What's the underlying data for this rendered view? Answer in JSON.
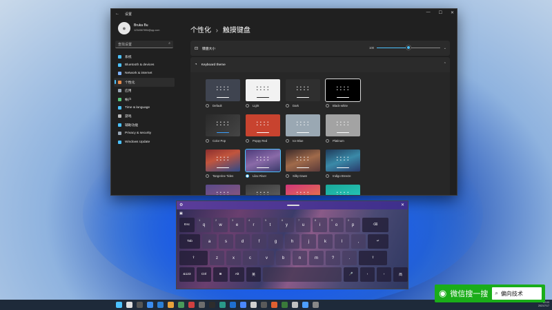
{
  "settings": {
    "window_title": "设置",
    "profile": {
      "name": "Bruka Bu",
      "email": "1234567894@qq.com"
    },
    "search_placeholder": "查找设置",
    "nav": [
      {
        "label": "系统",
        "color": "#4cc2ff"
      },
      {
        "label": "Bluetooth & devices",
        "color": "#4cc2ff"
      },
      {
        "label": "Network & internet",
        "color": "#7fb3ff"
      },
      {
        "label": "个性化",
        "color": "#e88c4c",
        "active": true
      },
      {
        "label": "应用",
        "color": "#9aa7b5"
      },
      {
        "label": "帐户",
        "color": "#59c47a"
      },
      {
        "label": "Time & language",
        "color": "#4cc2ff"
      },
      {
        "label": "游戏",
        "color": "#bbbbbb"
      },
      {
        "label": "辅助功能",
        "color": "#4cc2ff"
      },
      {
        "label": "Privacy & security",
        "color": "#9aa7b5"
      },
      {
        "label": "Windows Update",
        "color": "#4cc2ff"
      }
    ],
    "breadcrumb": {
      "parent": "个性化",
      "separator": "›",
      "current": "触摸键盘"
    },
    "keyboard_size": {
      "label": "键盘大小",
      "value": "100",
      "fraction": 0.5
    },
    "keyboard_theme": {
      "label": "Keyboard theme",
      "themes": [
        {
          "name": "Default",
          "bg": "#3f4450",
          "key": "#ffffff",
          "bar": "#ffffff"
        },
        {
          "name": "Light",
          "bg": "#f2f2f2",
          "key": "#222222",
          "bar": "#222222"
        },
        {
          "name": "Dark",
          "bg": "#2f2f2f",
          "key": "#ffffff",
          "bar": "#ffffff"
        },
        {
          "name": "Black-white",
          "bg": "#000000",
          "key": "#ffffff",
          "bar": "#ffffff",
          "border": true
        },
        {
          "name": "Color Pop",
          "bg": "linear-gradient(135deg,#2a2a2a,#454545)",
          "key": "#ffffff",
          "bar": "#3aa0ff"
        },
        {
          "name": "Poppy Red",
          "bg": "#c8432f",
          "key": "#ffffff",
          "bar": "#ffffff"
        },
        {
          "name": "Ice Blue",
          "bg": "#9aa8b3",
          "key": "#ffffff",
          "bar": "#ffffff"
        },
        {
          "name": "Platinum",
          "bg": "#a3a3a3",
          "key": "#ffffff",
          "bar": "#ffffff"
        },
        {
          "name": "Tangerine Tides",
          "bg": "linear-gradient(160deg,#8a2e2e,#c2553d 40%,#2e4a8a)",
          "key": "#ffffff",
          "bar": "#ffffff"
        },
        {
          "name": "Lilac River",
          "bg": "linear-gradient(160deg,#4b3b7a,#8a6aa8 50%,#3a3a6a)",
          "key": "#ffffff",
          "bar": "#ffffff",
          "selected": true
        },
        {
          "name": "Silky Dawn",
          "bg": "linear-gradient(160deg,#3a2a2a,#a06a4a 50%,#5a3a3a)",
          "key": "#ffffff",
          "bar": "#ffffff"
        },
        {
          "name": "Indigo Breeze",
          "bg": "linear-gradient(160deg,#1f3a5a,#3a8aa8 50%,#2a3a6a)",
          "key": "#ffffff",
          "bar": "#ffffff"
        },
        {
          "name": "",
          "bg": "linear-gradient(160deg,#5a4a8a,#9a5a7a)",
          "key": "#ffffff",
          "bar": "#ffffff"
        },
        {
          "name": "",
          "bg": "linear-gradient(160deg,#3a3a3a,#6a6a6a)",
          "key": "#ffffff",
          "bar": "#ffffff"
        },
        {
          "name": "",
          "bg": "linear-gradient(160deg,#d0357a,#f08a3a)",
          "key": "#ffffff",
          "bar": "#ffffff"
        },
        {
          "name": "",
          "bg": "linear-gradient(160deg,#1aa89a,#2ad0c0)",
          "key": "#ffffff",
          "bar": "#ffffff"
        }
      ]
    }
  },
  "keyboard": {
    "rows": [
      [
        {
          "l": "Esc",
          "w": 22,
          "dark": true
        },
        {
          "l": "q",
          "n": "1",
          "w": 21
        },
        {
          "l": "w",
          "n": "2",
          "w": 21
        },
        {
          "l": "e",
          "n": "3",
          "w": 21
        },
        {
          "l": "r",
          "n": "4",
          "w": 21
        },
        {
          "l": "t",
          "n": "5",
          "w": 21
        },
        {
          "l": "y",
          "n": "6",
          "w": 21
        },
        {
          "l": "u",
          "n": "7",
          "w": 21
        },
        {
          "l": "i",
          "n": "8",
          "w": 21
        },
        {
          "l": "o",
          "n": "9",
          "w": 21
        },
        {
          "l": "p",
          "n": "0",
          "w": 21
        },
        {
          "l": "⌫",
          "w": 38,
          "dark": true
        }
      ],
      [
        {
          "l": "Tab",
          "w": 30,
          "dark": true
        },
        {
          "l": "a",
          "w": 21
        },
        {
          "l": "s",
          "w": 21
        },
        {
          "l": "d",
          "w": 21
        },
        {
          "l": "f",
          "w": 21
        },
        {
          "l": "g",
          "w": 21
        },
        {
          "l": "h",
          "w": 21
        },
        {
          "l": "j",
          "w": 21
        },
        {
          "l": "k",
          "w": 21
        },
        {
          "l": "l",
          "w": 21
        },
        {
          "l": ",",
          "w": 21
        },
        {
          "l": "↵",
          "w": 30,
          "dark": true
        }
      ],
      [
        {
          "l": "⇧",
          "w": 41,
          "dark": true
        },
        {
          "l": "z",
          "w": 21
        },
        {
          "l": "x",
          "w": 21
        },
        {
          "l": "c",
          "w": 21
        },
        {
          "l": "v",
          "w": 21
        },
        {
          "l": "b",
          "w": 21
        },
        {
          "l": "n",
          "w": 21
        },
        {
          "l": "m",
          "w": 21
        },
        {
          "l": "?",
          "w": 21
        },
        {
          "l": ".",
          "w": 21
        },
        {
          "l": "⇧",
          "w": 41,
          "dark": true
        }
      ],
      [
        {
          "l": "&123",
          "w": 22,
          "dark": true
        },
        {
          "l": "Ctrl",
          "w": 21,
          "dark": true
        },
        {
          "l": "⊞",
          "w": 21,
          "dark": true
        },
        {
          "l": "Alt",
          "w": 21,
          "dark": true
        },
        {
          "l": "英",
          "w": 21,
          "dark": true
        },
        {
          "l": "",
          "w": 114,
          "space": true
        },
        {
          "l": "🎤",
          "w": 21,
          "dark": true
        },
        {
          "l": "‹",
          "w": 21,
          "dark": true
        },
        {
          "l": "›",
          "w": 21,
          "dark": true
        },
        {
          "l": "简",
          "w": 21,
          "dark": true
        }
      ]
    ]
  },
  "taskbar": {
    "icons": [
      "#4cc2ff",
      "#dddddd",
      "#555555",
      "#3c8df0",
      "#2b7fd6",
      "#e9a23b",
      "#4a9a5a",
      "#d04040",
      "#6e6e6e",
      "#2d2d2d",
      "#2a9a8a",
      "#1f6fd0",
      "#4a88ff",
      "#d0d0d0",
      "#5a5a5a",
      "#e06030",
      "#3a7a3a",
      "#c0c0c0",
      "#4d9fff",
      "#888888"
    ],
    "time": "22:03",
    "date": "2021/7/17"
  },
  "watermark": {
    "app": "微信搜一搜",
    "query": "偏向技术"
  }
}
